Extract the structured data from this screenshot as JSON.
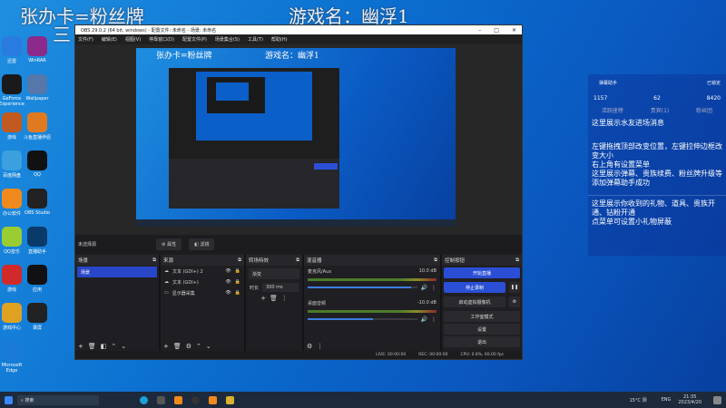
{
  "overlay": {
    "card_text": "张办卡=粉丝牌",
    "game_text": "游戏名：幽浮1",
    "partial_text": "三"
  },
  "desktop_icons": [
    {
      "label": "迅雷"
    },
    {
      "label": "WinRAR"
    },
    {
      "label": "GeForce Experience"
    },
    {
      "label": "Wallpaper"
    },
    {
      "label": "游戏"
    },
    {
      "label": "斗鱼直播伴侣"
    },
    {
      "label": "百度网盘"
    },
    {
      "label": "QQ"
    },
    {
      "label": "办公软件"
    },
    {
      "label": "OBS Studio"
    },
    {
      "label": "QQ音乐"
    },
    {
      "label": "直播助手"
    },
    {
      "label": "游戏"
    },
    {
      "label": "应用"
    },
    {
      "label": "游戏中心"
    },
    {
      "label": "录屏"
    },
    {
      "label": "Microsoft Edge"
    }
  ],
  "obs": {
    "title": "OBS 29.0.2 (64 bit, windows) - 配置文件: 未命名 - 场景: 未命名",
    "window_controls": [
      "–",
      "□",
      "✕"
    ],
    "menu": [
      "文件(F)",
      "编辑(E)",
      "视图(V)",
      "停靠窗口(D)",
      "配置文件(P)",
      "场景集合(S)",
      "工具(T)",
      "帮助(H)"
    ],
    "preview_overlay": {
      "card": "张办卡=粉丝牌",
      "game": "游戏名：幽浮1"
    },
    "source_bar": {
      "label": "未选择源",
      "properties": "属性",
      "filters": "滤镜"
    },
    "docks": {
      "scenes": {
        "title": "场景",
        "items": [
          "场景"
        ]
      },
      "sources": {
        "title": "来源",
        "items": [
          "文本 (GDI+) 2",
          "文本 (GDI+)",
          "显示器采集"
        ]
      },
      "transitions": {
        "title": "转场特效",
        "type": "渐变",
        "duration_label": "时长",
        "duration": "300 ms"
      },
      "mixer": {
        "title": "混音器",
        "channels": [
          {
            "name": "麦克风/Aux",
            "db": "10.0 dB",
            "volume": 0.95
          },
          {
            "name": "桌面音频",
            "db": "-10.0 dB",
            "volume": 0.6
          }
        ]
      },
      "controls": {
        "title": "控制按钮",
        "buttons": [
          "开始直播",
          "停止录制",
          "启动虚拟摄像机",
          "工作室模式",
          "设置",
          "退出"
        ]
      }
    },
    "status": {
      "live": "LIVE: 00:00:00",
      "rec": "REC: 00:00:00",
      "cpu": "CPU: 0.8%, 60.00 fps"
    }
  },
  "panel": {
    "title": "弹幕助手",
    "status": "已锁定",
    "likes": "1157",
    "viewers": "62",
    "hearts": "8420",
    "tabs": [
      "活跃座榜",
      "贵宾(1)",
      "粉丝团"
    ],
    "msg1": "这里展示水友进场消息",
    "msg2": [
      "左键拖拽顶部改变位置，左键拉伸边框改变大小",
      "右上角有设置菜单",
      "这里展示弹幕、贵族续费、粉丝牌升级等",
      "添加弹幕助手成功"
    ],
    "msg3": [
      "这里展示你收到的礼物、道具、贵族开通、钻粉开通",
      "点菜单可设置小礼物屏蔽"
    ]
  },
  "taskbar": {
    "search": "搜索",
    "weather": "15°C 阴",
    "lang": "ENG",
    "time": "21:35",
    "date": "2023/4/20"
  }
}
